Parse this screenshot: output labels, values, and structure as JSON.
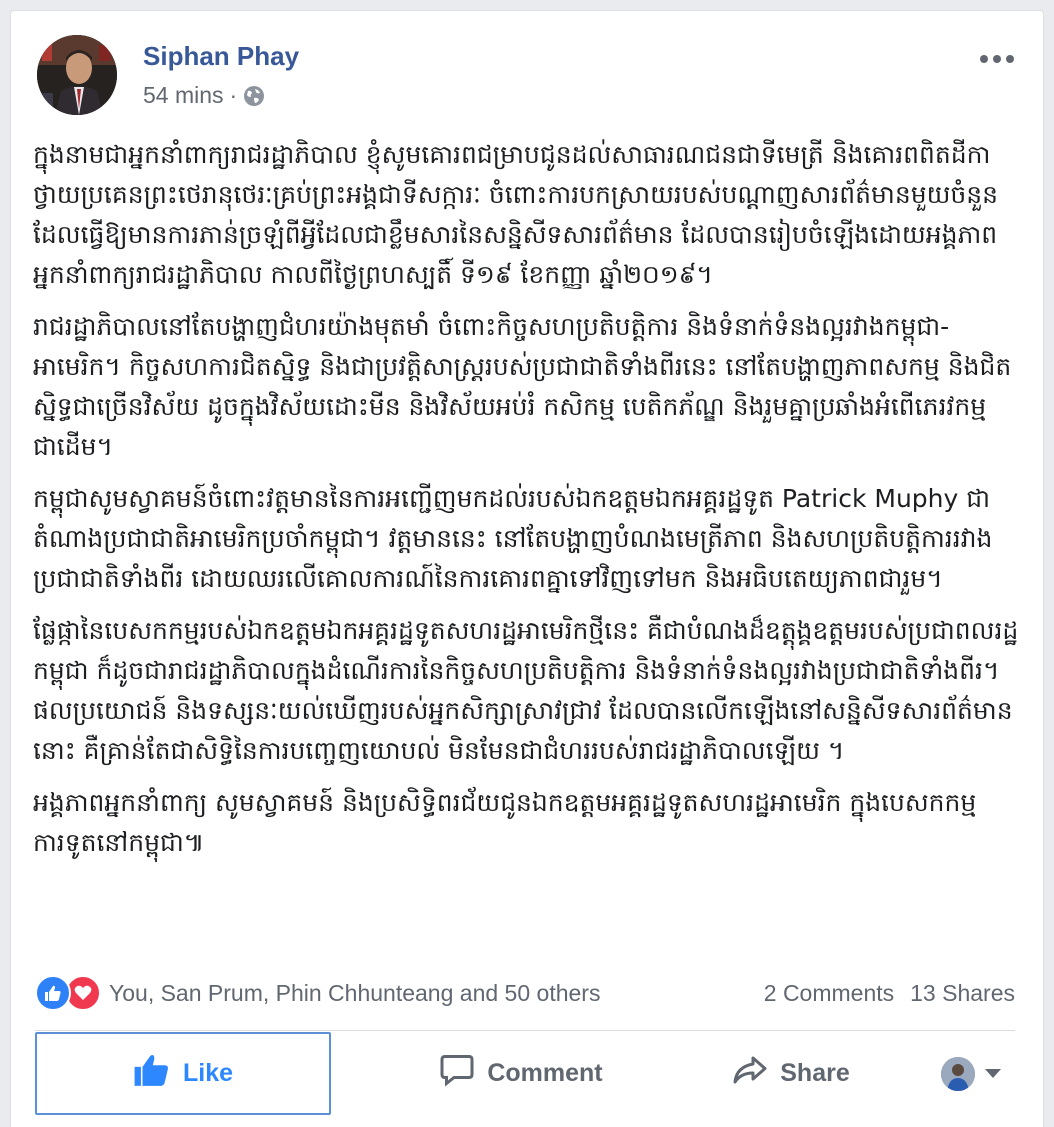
{
  "post": {
    "author": "Siphan Phay",
    "time": "54 mins",
    "separator": "·",
    "privacy_icon": "globe-icon",
    "more_icon": "more-horizontal-icon",
    "paragraphs": [
      "ក្នុងនាមជាអ្នកនាំពាក្យរាជរដ្ឋាភិបាល ខ្ញុំសូមគោរពជម្រាបជូនដល់សាធារណជនជាទីមេត្រី និងគោរពពិតដីកាថ្វាយប្រគេនព្រះថេរានុថេរៈគ្រប់ព្រះអង្គជាទីសក្ការៈ ចំពោះការបកស្រាយរបស់បណ្ដាញសារព័ត៌មានមួយចំនួន ដែលធ្វើឱ្យមានការភាន់ច្រឡំពីអ្វីដែលជាខ្លឹមសារនៃសន្និសីទសារព័ត៌មាន ដែលបានរៀបចំឡើងដោយអង្គភាពអ្នកនាំពាក្យរាជរដ្ឋាភិបាល កាលពីថ្ងៃព្រហស្បតិ៍ ទី១៩ ខែកញ្ញា ឆ្នាំ២០១៩។",
      "រាជរដ្ឋាភិបាលនៅតែបង្ហាញជំហរយ៉ាងមុតមាំ ចំពោះកិច្ចសហប្រតិបត្តិការ និងទំនាក់ទំនងល្អរវាងកម្ពុជា-អាមេរិក។ កិច្ចសហការជិតស្និទ្ធ និងជាប្រវត្តិសាស្ត្ររបស់ប្រជាជាតិទាំងពីរនេះ នៅតែបង្ហាញភាពសកម្ម និងជិតស្និទ្ធជាច្រើនវិស័យ ដូចក្នុងវិស័យដោះមីន និងវិស័យអប់រំ កសិកម្ម បេតិកភ័ណ្ឌ និងរួមគ្នាប្រឆាំងអំពើភេរវកម្មជាដើម។",
      "កម្ពុជាសូមស្វាគមន៍ចំពោះវត្តមាននៃការអញ្ជើញមកដល់របស់ឯកឧត្តមឯកអគ្គរដ្ឋទូត Patrick Muphy ជាតំណាងប្រជាជាតិអាមេរិកប្រចាំកម្ពុជា។ វត្តមាននេះ នៅតែបង្ហាញបំណងមេត្រីភាព និងសហប្រតិបត្តិការរវាងប្រជាជាតិទាំងពីរ ដោយឈរលើគោលការណ៍នៃការគោរពគ្នាទៅវិញទៅមក និងអធិបតេយ្យភាពជារួម។",
      "ផ្លែផ្កានៃបេសកកម្មរបស់ឯកឧត្តមឯកអគ្គរដ្ឋទូតសហរដ្ឋអាមេរិកថ្មីនេះ គឺជាបំណងដ៏ឧត្តុង្គឧត្ដមរបស់ប្រជាពលរដ្ឋកម្ពុជា ក៏ដូចជារាជរដ្ឋាភិបាលក្នុងដំណើរការនៃកិច្ចសហប្រតិបត្តិការ និងទំនាក់ទំនងល្អរវាងប្រជាជាតិទាំងពីរ។ ផលប្រយោជន៍ និងទស្សនៈយល់ឃើញរបស់អ្នកសិក្សាស្រាវជ្រាវ ដែលបានលើកឡើងនៅសន្និសីទសារព័ត៌មាននោះ គឺគ្រាន់តែជាសិទ្ធិនៃការបញ្ចេញយោបល់ មិនមែនជាជំហររបស់រាជរដ្ឋាភិបាលឡើយ ។",
      "អង្គភាពអ្នកនាំពាក្យ សូមស្វាគមន៍ និងប្រសិទ្ធិពរជ័យជូនឯកឧត្តមអគ្គរដ្ឋទូតសហរដ្ឋអាមេរិក ក្នុងបេសកកម្មការទូតនៅកម្ពុជា៕"
    ]
  },
  "reactions": {
    "icons": [
      "like-reaction-icon",
      "love-reaction-icon"
    ],
    "names": "You, San Prum, Phin Chhunteang and 50 others",
    "comments": "2 Comments",
    "shares": "13 Shares"
  },
  "actions": {
    "like": "Like",
    "comment": "Comment",
    "share": "Share",
    "audience_icon": "chevron-down-icon"
  },
  "colors": {
    "link": "#385898",
    "like_active": "#2d88ff",
    "like_reaction": "#2e81f7",
    "love_reaction": "#f0384f",
    "muted": "#606770"
  }
}
